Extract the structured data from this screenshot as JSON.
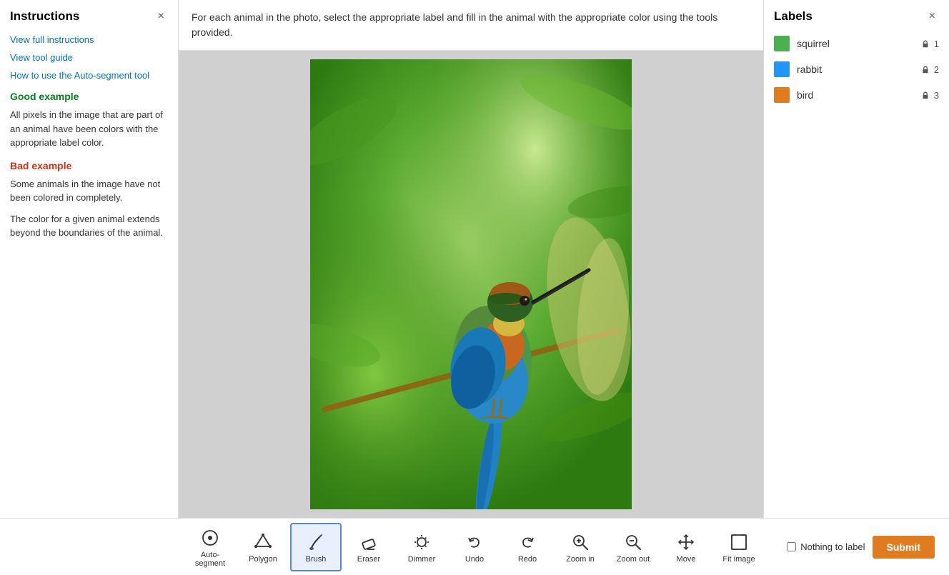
{
  "sidebar": {
    "title": "Instructions",
    "close_label": "×",
    "links": [
      {
        "id": "view-full-instructions",
        "label": "View full instructions"
      },
      {
        "id": "view-tool-guide",
        "label": "View tool guide"
      },
      {
        "id": "auto-segment-guide",
        "label": "How to use the Auto-segment tool"
      }
    ],
    "good_example": {
      "heading": "Good example",
      "text": "All pixels in the image that are part of an animal have been colors with the appropriate label color."
    },
    "bad_example": {
      "heading": "Bad example",
      "text1": "Some animals in the image have not been colored in completely.",
      "text2": "The color for a given animal extends beyond the boundaries of the animal."
    }
  },
  "instruction_bar": {
    "text": "For each animal in the photo, select the appropriate label and fill in the animal with the appropriate color using the tools provided."
  },
  "labels": {
    "title": "Labels",
    "close_label": "×",
    "items": [
      {
        "name": "squirrel",
        "color": "#4caf50",
        "count": 1
      },
      {
        "name": "rabbit",
        "color": "#2196f3",
        "count": 2
      },
      {
        "name": "bird",
        "color": "#e07b20",
        "count": 3
      }
    ]
  },
  "toolbar": {
    "tools": [
      {
        "id": "auto-segment",
        "label": "Auto-segment"
      },
      {
        "id": "polygon",
        "label": "Polygon"
      },
      {
        "id": "brush",
        "label": "Brush",
        "active": true
      },
      {
        "id": "eraser",
        "label": "Eraser"
      },
      {
        "id": "dimmer",
        "label": "Dimmer"
      },
      {
        "id": "undo",
        "label": "Undo"
      },
      {
        "id": "redo",
        "label": "Redo"
      },
      {
        "id": "zoom-in",
        "label": "Zoom in"
      },
      {
        "id": "zoom-out",
        "label": "Zoom out"
      },
      {
        "id": "move",
        "label": "Move"
      },
      {
        "id": "fit-image",
        "label": "Fit image"
      }
    ],
    "nothing_to_label": "Nothing to label",
    "submit": "Submit"
  },
  "colors": {
    "link": "#0073bb",
    "good_heading": "#067f23",
    "bad_heading": "#d13212",
    "active_tool_border": "#5c85d6",
    "active_tool_bg": "#e8f0fe",
    "submit_btn": "#e07b20"
  }
}
